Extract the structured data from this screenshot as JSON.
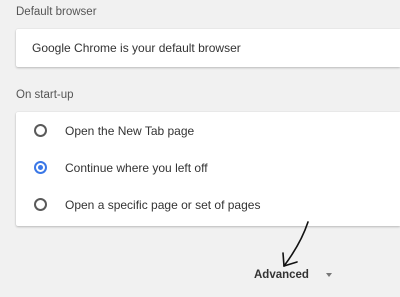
{
  "default_browser": {
    "section_title": "Default browser",
    "status_text": "Google Chrome is your default browser"
  },
  "startup": {
    "section_title": "On start-up",
    "options": [
      {
        "label": "Open the New Tab page",
        "checked": false
      },
      {
        "label": "Continue where you left off",
        "checked": true
      },
      {
        "label": "Open a specific page or set of pages",
        "checked": false
      }
    ]
  },
  "advanced": {
    "label": "Advanced",
    "icon": "chevron-down-icon"
  },
  "colors": {
    "accent": "#3b78e7",
    "background": "#f1f1f1",
    "card": "#ffffff"
  }
}
